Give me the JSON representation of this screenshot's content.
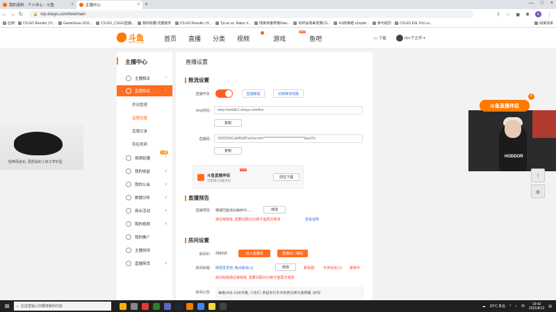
{
  "browser": {
    "tabs": [
      {
        "title": "我的资料 - 个人中心 - 斗鱼",
        "active": false
      },
      {
        "title": "主播中心",
        "active": true
      }
    ],
    "url": "mp.douyu.com/live/main",
    "bookmarks": [
      "应用",
      "CS:GO Results | H...",
      "GameGune 2011...",
      "CS:GO_CSGO直播...",
      "我的收藏-优酷收件",
      "CS:GO Results | H...",
      "TyLoo vs. Natus V...",
      "残疾单番表格Xian...",
      "年终会场美发赛CS...",
      "4.0的两者 s1mple...",
      "参与经历",
      "CS:GO ESL Pro Le..."
    ],
    "reading_list": "阅读清单",
    "profile_letter": "K"
  },
  "header": {
    "logo_text": "斗鱼",
    "logo_sub": "DOUYU.COM",
    "nav": [
      "首页",
      "直播",
      "分类",
      "视频",
      "游戏",
      "鱼吧"
    ],
    "download": "下载",
    "username": "dee下正拌"
  },
  "promo": {
    "text": "轻奔而进化, 更舒适的人体工学外型"
  },
  "sidebar": {
    "title": "主播中心",
    "items": [
      {
        "label": "主播相关",
        "chev": "^"
      },
      {
        "label": "直播相关",
        "chev": "^"
      },
      {
        "label": "视频轮播",
        "chev": "^",
        "badge": "上线"
      },
      {
        "label": "我的收益",
        "chev": "v"
      },
      {
        "label": "我的公会",
        "chev": "v"
      },
      {
        "label": "数据分析",
        "chev": "v"
      },
      {
        "label": "商业活动",
        "chev": "v"
      },
      {
        "label": "我的视频",
        "chev": "v"
      },
      {
        "label": "我的推广",
        "chev": ""
      },
      {
        "label": "主播扶持",
        "chev": ""
      },
      {
        "label": "直播带货",
        "chev": "v"
      }
    ],
    "subitems": [
      "房间管理",
      "直播设置",
      "直播记录",
      "剪贴视频"
    ]
  },
  "content": {
    "title": "直播设置",
    "push": {
      "section": "推流设置",
      "switch_label": "直播开关:",
      "tutorial_btn": "直播教程",
      "switch_route_btn": "切换推流线路",
      "rtmp_label": "rtmp地址:",
      "rtmp_value": "rtmp://sendtc1.douyu.com/live",
      "copy": "复制",
      "code_label": "直播码:",
      "code_value": "293018rlCukMGtlfTwsSecret=******************************&wsTin",
      "copy2": "复制"
    },
    "banner": {
      "name": "斗鱼直播伴侣",
      "new": "NEW",
      "desc": "仅需填1次推流码",
      "download_btn": "前往下载"
    },
    "preview": {
      "section": "直播预告",
      "label": "直播预告:",
      "value": "哪傩同盘演出静养中......",
      "modify": "修改",
      "status": "通过审核批, 需要间隔10分钟才能再次修改",
      "link": "查看说明"
    },
    "room": {
      "section": "房间设置",
      "id_label": "房间ID:",
      "id_value": "293018",
      "enter_btn": "进入直播间",
      "qr_btn": "直播间二维码",
      "title_label": "房间标题:",
      "title_value": "随便发发用, 晚点解说LQ",
      "modify": "修改",
      "new_title_label": "新标题:",
      "new_title_value": "今天玩玩1.6",
      "review": "审核中",
      "status": "房间标题通过审核批, 需要间隔10分钟才能再次修改",
      "notice_label": "房间公告:",
      "notice_value": "每晚18点-19点开播, 少年们, 拿起你们手中的荧光棒为我照耀, 好吗!"
    }
  },
  "overlay": {
    "banner": "斗鱼直播伴侣",
    "close": "×",
    "shirt": "HODDOR"
  },
  "taskbar": {
    "search_placeholder": "在这里输入你要搜索的内容",
    "weather": "23°C 多云",
    "lang": "中",
    "time": "19:42",
    "date": "2021/8/12"
  }
}
